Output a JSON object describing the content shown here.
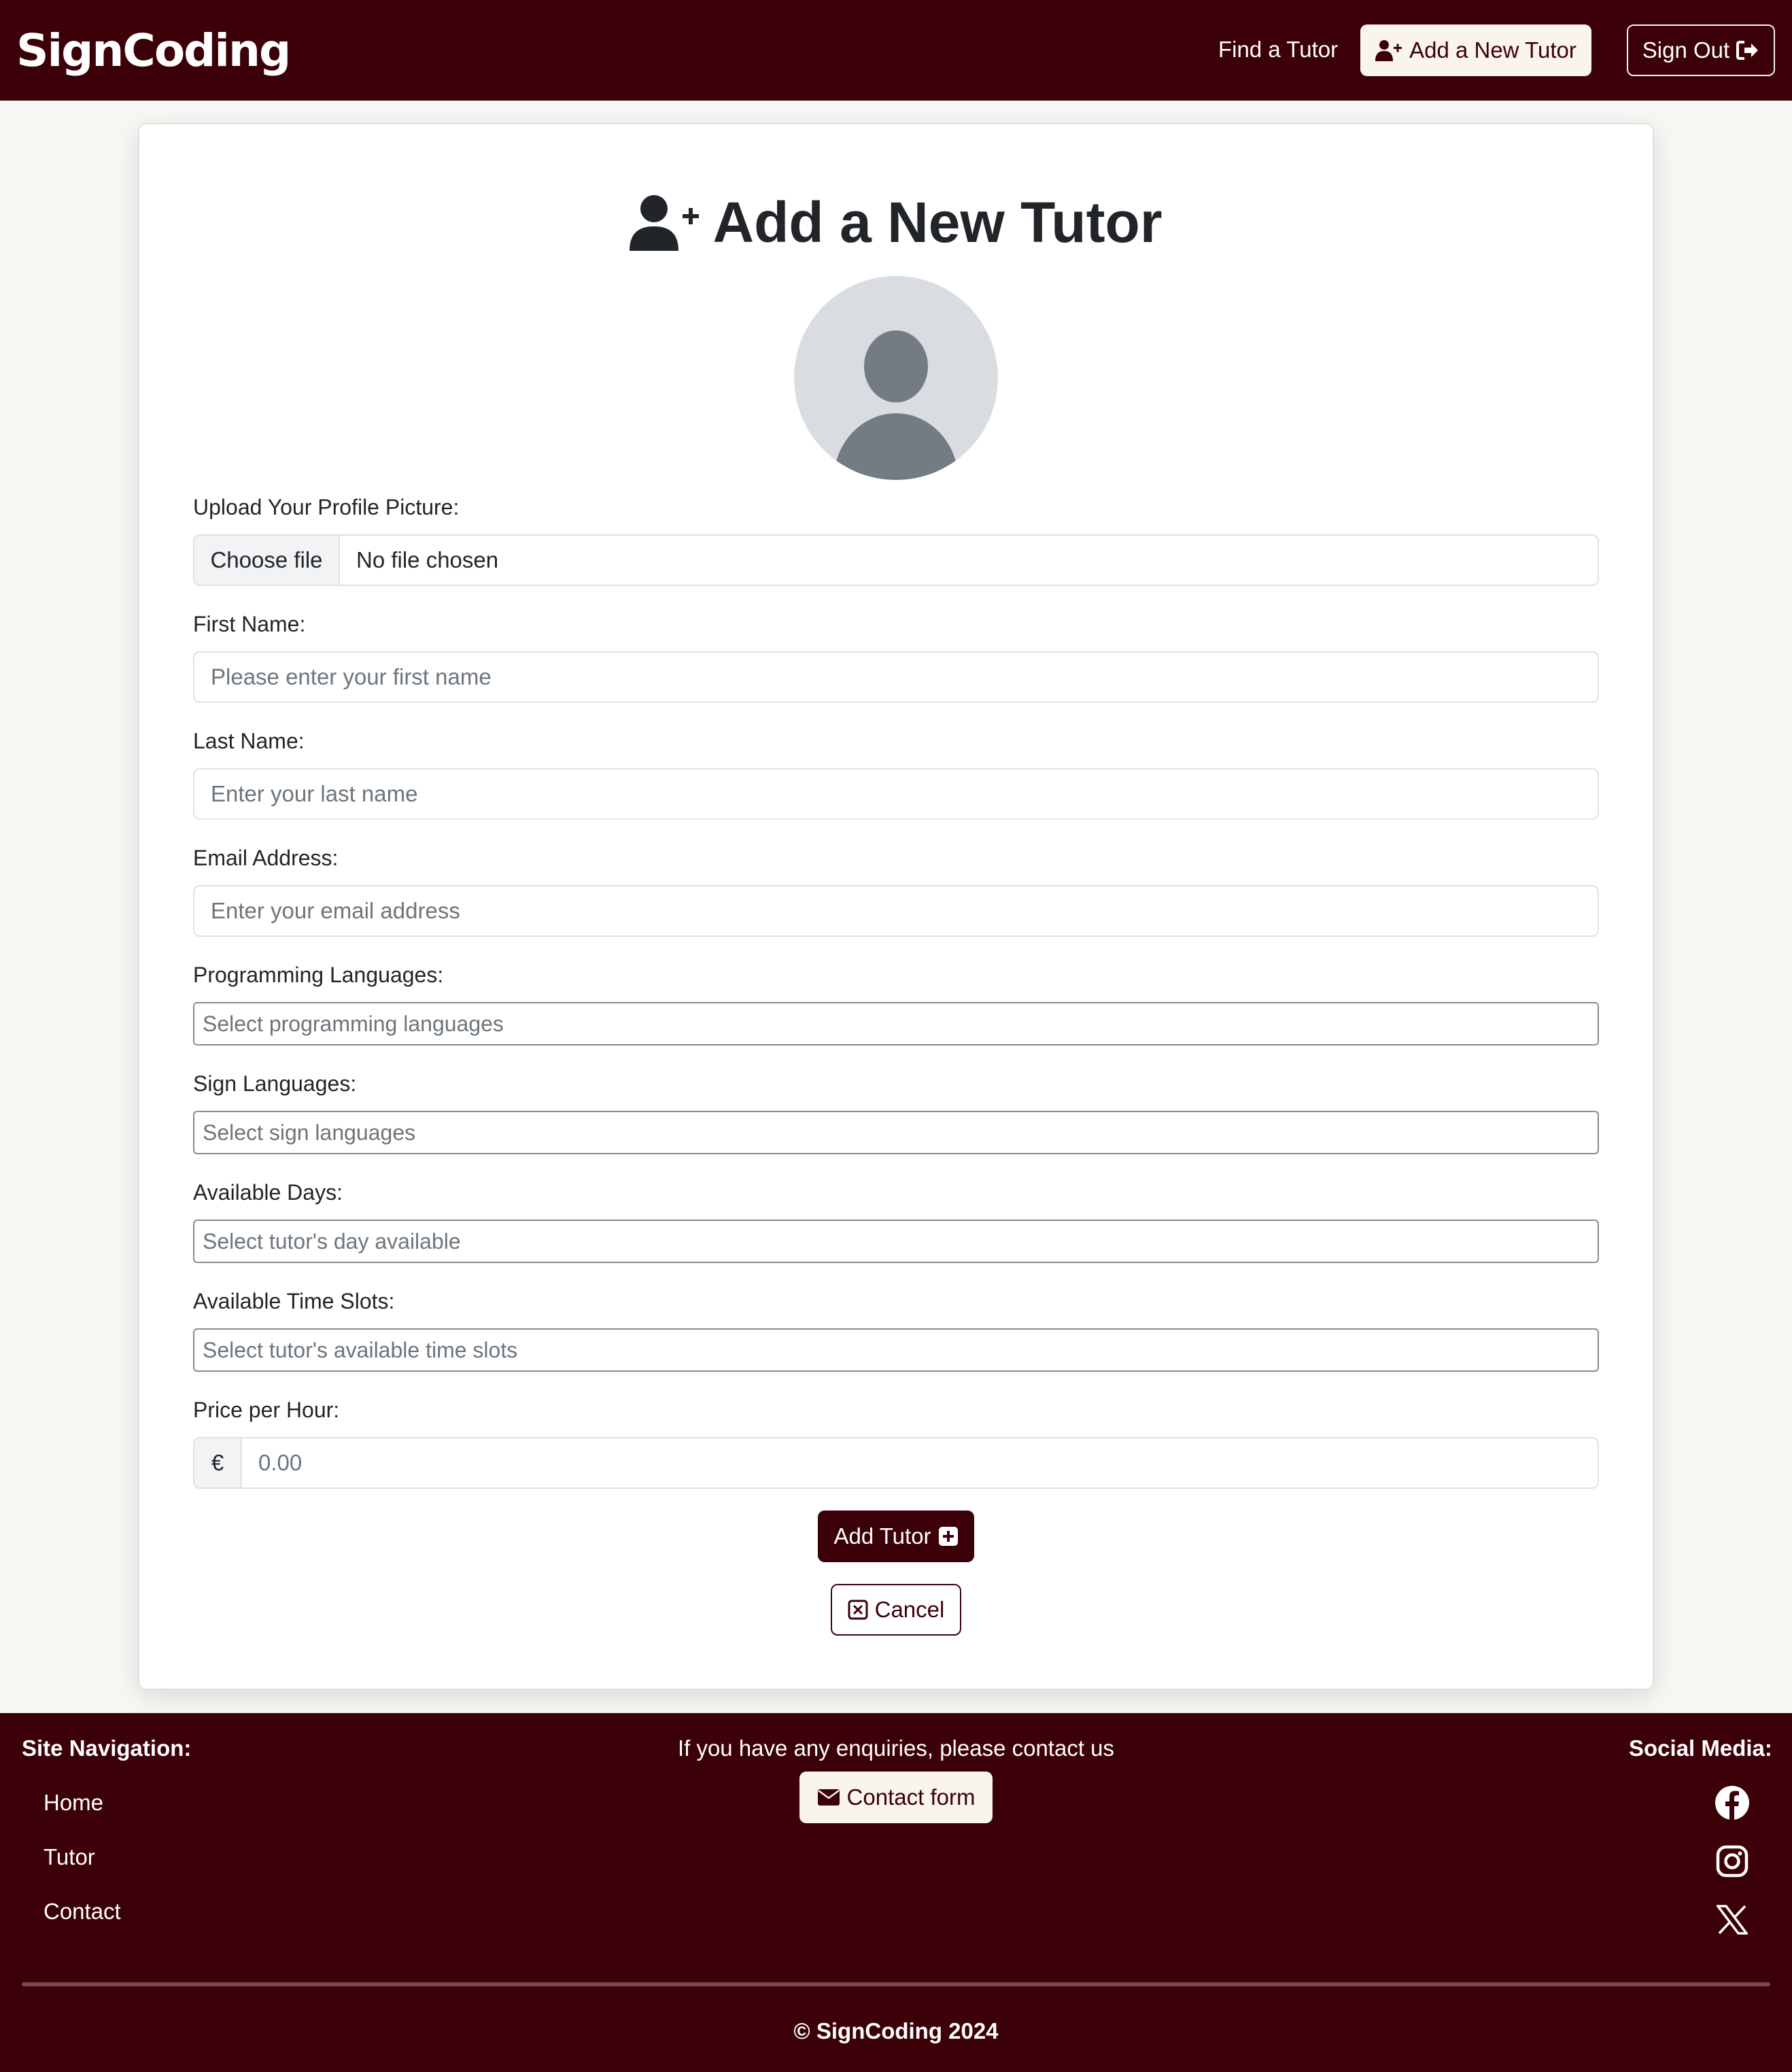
{
  "header": {
    "brand": "SignCoding",
    "nav_find": "Find a Tutor",
    "nav_add": "Add a New Tutor",
    "nav_signout": "Sign Out"
  },
  "form": {
    "title": "Add a New Tutor",
    "upload_label": "Upload Your Profile Picture:",
    "file_button": "Choose file",
    "file_status": "No file chosen",
    "first_name_label": "First Name:",
    "first_name_placeholder": "Please enter your first name",
    "last_name_label": "Last Name:",
    "last_name_placeholder": "Enter your last name",
    "email_label": "Email Address:",
    "email_placeholder": "Enter your email address",
    "prog_lang_label": "Programming Languages:",
    "prog_lang_placeholder": "Select programming languages",
    "sign_lang_label": "Sign Languages:",
    "sign_lang_placeholder": "Select sign languages",
    "days_label": "Available Days:",
    "days_placeholder": "Select tutor's day available",
    "slots_label": "Available Time Slots:",
    "slots_placeholder": "Select tutor's available time slots",
    "price_label": "Price per Hour:",
    "price_currency": "€",
    "price_placeholder": "0.00",
    "submit_label": "Add Tutor",
    "cancel_label": "Cancel"
  },
  "footer": {
    "nav_heading": "Site Navigation:",
    "nav_links": [
      "Home",
      "Tutor",
      "Contact"
    ],
    "enquiry_text": "If you have any enquiries, please contact us",
    "contact_button": "Contact form",
    "social_heading": "Social Media:",
    "social_icons": [
      "facebook-icon",
      "instagram-icon",
      "x-icon"
    ],
    "copyright": "© SignCoding 2024"
  },
  "colors": {
    "brand_dark": "#3b0008",
    "cream": "#f9f4ec",
    "page_bg": "#f8f7f4"
  }
}
